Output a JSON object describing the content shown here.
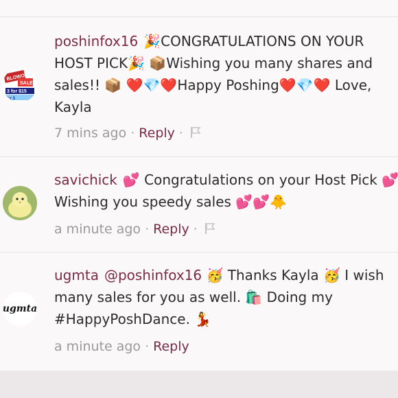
{
  "comments": [
    {
      "username": "poshinfox16",
      "lines": [
        "🎉CONGRATULATIONS ON YOUR",
        "HOST PICK🎉 📦Wishing you many shares and",
        "sales!! 📦 ❤️💎❤️Happy Poshing❤️💎❤️ Love,",
        "Kayla"
      ],
      "time": "7 mins ago",
      "reply_label": "Reply",
      "avatar_text": [
        "BLOWOUT",
        "SALE",
        "3 for $15",
        "for $"
      ]
    },
    {
      "username": "savichick",
      "lines": [
        "💕 Congratulations on your Host Pick 💕",
        "Wishing you speedy sales 💕💕🐥"
      ],
      "time": "a minute ago",
      "reply_label": "Reply"
    },
    {
      "username": "ugmta",
      "mention": "@poshinfox16",
      "lines": [
        "🥳 Thanks Kayla 🥳 I wish",
        "many sales for you as well. 🛍️ Doing my",
        "#HappyPoshDance. 💃"
      ],
      "time": "a minute ago",
      "reply_label": "Reply",
      "avatar_text": "ugmta"
    }
  ],
  "icons": {
    "flag": "flag-icon"
  },
  "colors": {
    "username": "#7a2a45",
    "meta": "#9a9a9a",
    "background": "#fbf8f9"
  }
}
